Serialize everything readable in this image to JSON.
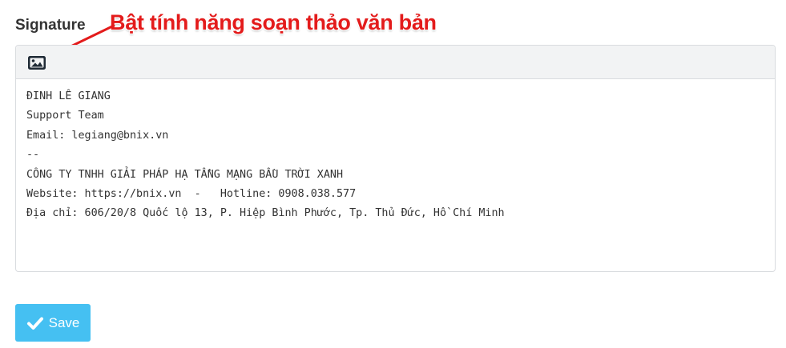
{
  "section": {
    "title": "Signature"
  },
  "annotation": {
    "text": "Bật tính năng soạn thảo văn bản",
    "color": "#e31b1b"
  },
  "editor": {
    "toolbar_icon": "image-icon",
    "lines": [
      "ĐINH LÊ GIANG",
      "Support Team",
      "Email: legiang@bnix.vn",
      "--",
      "CÔNG TY TNHH GIẢI PHÁP HẠ TẦNG MẠNG BẦU TRỜI XANH",
      "Website: https://bnix.vn  -   Hotline: 0908.038.577",
      "Địa chỉ: 606/20/8 Quốc lộ 13, P. Hiệp Bình Phước, Tp. Thủ Đức, Hồ Chí Minh"
    ]
  },
  "actions": {
    "save_label": "Save",
    "save_icon": "check-icon",
    "save_color": "#45c0f2"
  }
}
